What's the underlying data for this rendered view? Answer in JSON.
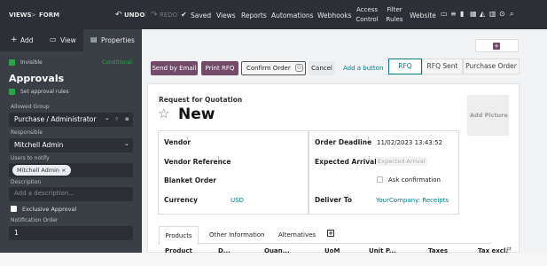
{
  "topbar": {
    "breadcrumb_part1": "VIEWS",
    "breadcrumb_sep": ">",
    "breadcrumb_part2": "FORM",
    "undo": "UNDO",
    "redo": "REDO",
    "saved": "Saved",
    "menu": [
      "Views",
      "Reports",
      "Automations",
      "Webhooks"
    ],
    "access_control": [
      "Access",
      "Control"
    ],
    "filter_rules": [
      "Filter",
      "Rules"
    ],
    "website": "Website"
  },
  "sidebar": {
    "add": "Add",
    "view": "View",
    "properties": "Properties",
    "invisible": "Invisible",
    "conditional": "Conditional",
    "title": "Approvals",
    "set_approval_rules": "Set approval rules",
    "allowed_group_label": "Allowed Group",
    "allowed_group_value": "Purchase / Administrator",
    "responsible_label": "Responsible",
    "responsible_value": "Mitchell Admin",
    "users_to_notify_label": "Users to notify",
    "users_to_notify_tag": "Mitchell Admin ×",
    "description_label": "Description",
    "description_placeholder": "Add a description...",
    "exclusive_approval": "Exclusive Approval",
    "notification_order_label": "Notification Order",
    "notification_order_value": "1"
  },
  "main": {
    "buttons": {
      "send_by_email": "Send by Email",
      "print_rfq": "Print RFQ",
      "confirm_order": "Confirm Order",
      "cancel": "Cancel",
      "add_button": "Add a button"
    },
    "statusbar": [
      "RFQ",
      "RFQ Sent",
      "Purchase Order"
    ],
    "form": {
      "subtitle": "Request for Quotation",
      "title": "New",
      "add_picture": "Add Picture",
      "vendor_label": "Vendor",
      "vendor_ref_label": "Vendor Reference",
      "blanket_order_label": "Blanket Order",
      "currency_label": "Currency",
      "currency_value": "USD",
      "order_deadline_label": "Order Deadline",
      "order_deadline_value": "11/02/2023 13:43:52",
      "expected_arrival_label": "Expected Arrival",
      "expected_arrival_placeholder": "Expected Arrival",
      "ask_confirmation": "Ask confirmation",
      "deliver_to_label": "Deliver To",
      "deliver_to_value": "YourCompany: Receipts",
      "help_mark": "?"
    },
    "tabs": [
      "Products",
      "Other Information",
      "Alternatives"
    ],
    "columns": [
      "Product",
      "D...",
      "Quan...",
      "UoM",
      "Unit P...",
      "Taxes",
      "Tax excl."
    ]
  },
  "colors": {
    "topbar": "#2c3036",
    "sidebar": "#3a3f46",
    "accent": "#714b67",
    "link": "#017e84",
    "green": "#28a745"
  }
}
